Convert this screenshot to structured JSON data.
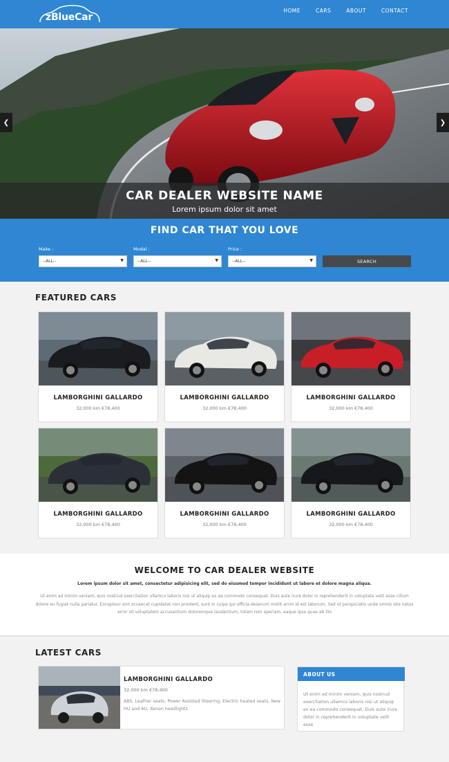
{
  "brand": {
    "name": "zBlueCar"
  },
  "nav": {
    "items": [
      "HOME",
      "CARS",
      "ABOUT",
      "CONTACT"
    ]
  },
  "hero": {
    "title": "CAR DEALER WEBSITE NAME",
    "subtitle": "Lorem ipsum dolor sit amet",
    "prev_icon": "chevron-left-icon",
    "next_icon": "chevron-right-icon"
  },
  "search": {
    "title": "FIND CAR THAT YOU LOVE",
    "fields": [
      {
        "label": "Make :",
        "value": "--ALL--"
      },
      {
        "label": "Modal :",
        "value": "--ALL--"
      },
      {
        "label": "Price :",
        "value": "--ALL--"
      }
    ],
    "button": "SEARCH"
  },
  "featured": {
    "title": "FEATURED CARS",
    "cars": [
      {
        "name": "LAMBORGHINI GALLARDO",
        "info": "32,000 km €78,400",
        "color": "#1a1c20"
      },
      {
        "name": "LAMBORGHINI GALLARDO",
        "info": "32,000 km €78,400",
        "color": "#e8e8e4"
      },
      {
        "name": "LAMBORGHINI GALLARDO",
        "info": "32,000 km €78,400",
        "color": "#c81e28"
      },
      {
        "name": "LAMBORGHINI GALLARDO",
        "info": "32,000 km €78,400",
        "color": "#2a2f38"
      },
      {
        "name": "LAMBORGHINI GALLARDO",
        "info": "32,000 km €78,400",
        "color": "#141414"
      },
      {
        "name": "LAMBORGHINI GALLARDO",
        "info": "32,000 km €78,400",
        "color": "#17181b"
      }
    ]
  },
  "welcome": {
    "title": "WELCOME TO CAR DEALER WEBSITE",
    "lead": "Lorem ipsum dolor sit amet, consectetur adipisicing elit, sed do eiusmod tempor incididunt ut labore et dolore magna aliqua.",
    "body": "Ut enim ad minim veniam, quis nostrud exercitation ullamco laboris nisi ut aliquip ex ea commodo consequat. Duis aute irure dolor in reprehenderit in voluptate velit esse cillum dolore eu fugiat nulla pariatur. Excepteur sint occaecat cupidatat non proident, sunt in culpa qui officia deserunt mollit anim id est laborum. Sed ut perspiciatis unde omnis iste natus error sit voluptatem accusantium doloremque laudantium, totam rem aperiam, eaque ipsa quae ab illo"
  },
  "latest": {
    "title": "LATEST CARS",
    "car": {
      "name": "LAMBORGHINI GALLARDO",
      "info": "32,000 km €78,400",
      "desc": "ABS, Leather seats, Power Assisted Steering, Electric heated seats, New HU and AU, Xenon headlights"
    }
  },
  "about": {
    "title": "ABOUT US",
    "text": "Ut enim ad minim veniam, quis nostrud exercitation ullamco laboris nisi ut aliquip ex ea commodo consequat. Duis aute irure dolor in reprehenderit in voluptate velit esse"
  },
  "colors": {
    "primary": "#2f86d3",
    "button_dark": "#464a4d",
    "hero_car": "#b3141c"
  }
}
